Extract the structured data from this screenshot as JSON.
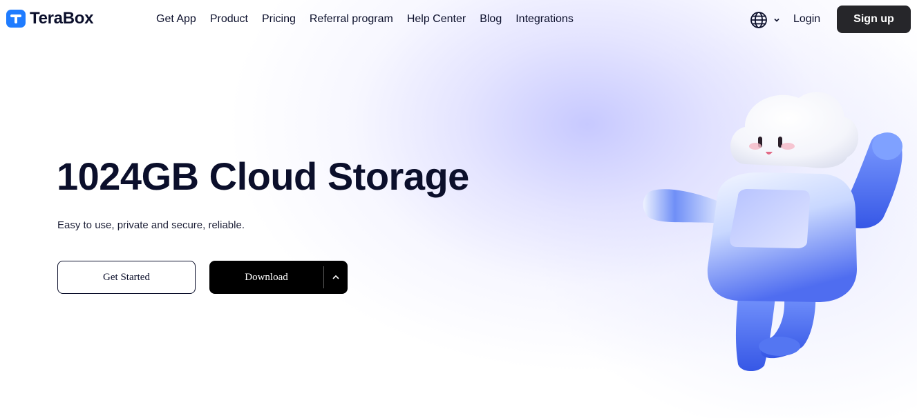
{
  "brand": {
    "name": "TeraBox",
    "primary_color": "#1f7cff"
  },
  "nav": {
    "items": [
      {
        "label": "Get App"
      },
      {
        "label": "Product"
      },
      {
        "label": "Pricing"
      },
      {
        "label": "Referral program"
      },
      {
        "label": "Help Center"
      },
      {
        "label": "Blog"
      },
      {
        "label": "Integrations"
      }
    ]
  },
  "header": {
    "language_icon": "globe-icon",
    "login_label": "Login",
    "signup_label": "Sign up"
  },
  "hero": {
    "title": "1024GB Cloud Storage",
    "subtitle": "Easy to use, private and secure, reliable.",
    "get_started_label": "Get Started",
    "download_label": "Download",
    "download_menu_icon": "chevron-up-icon"
  }
}
